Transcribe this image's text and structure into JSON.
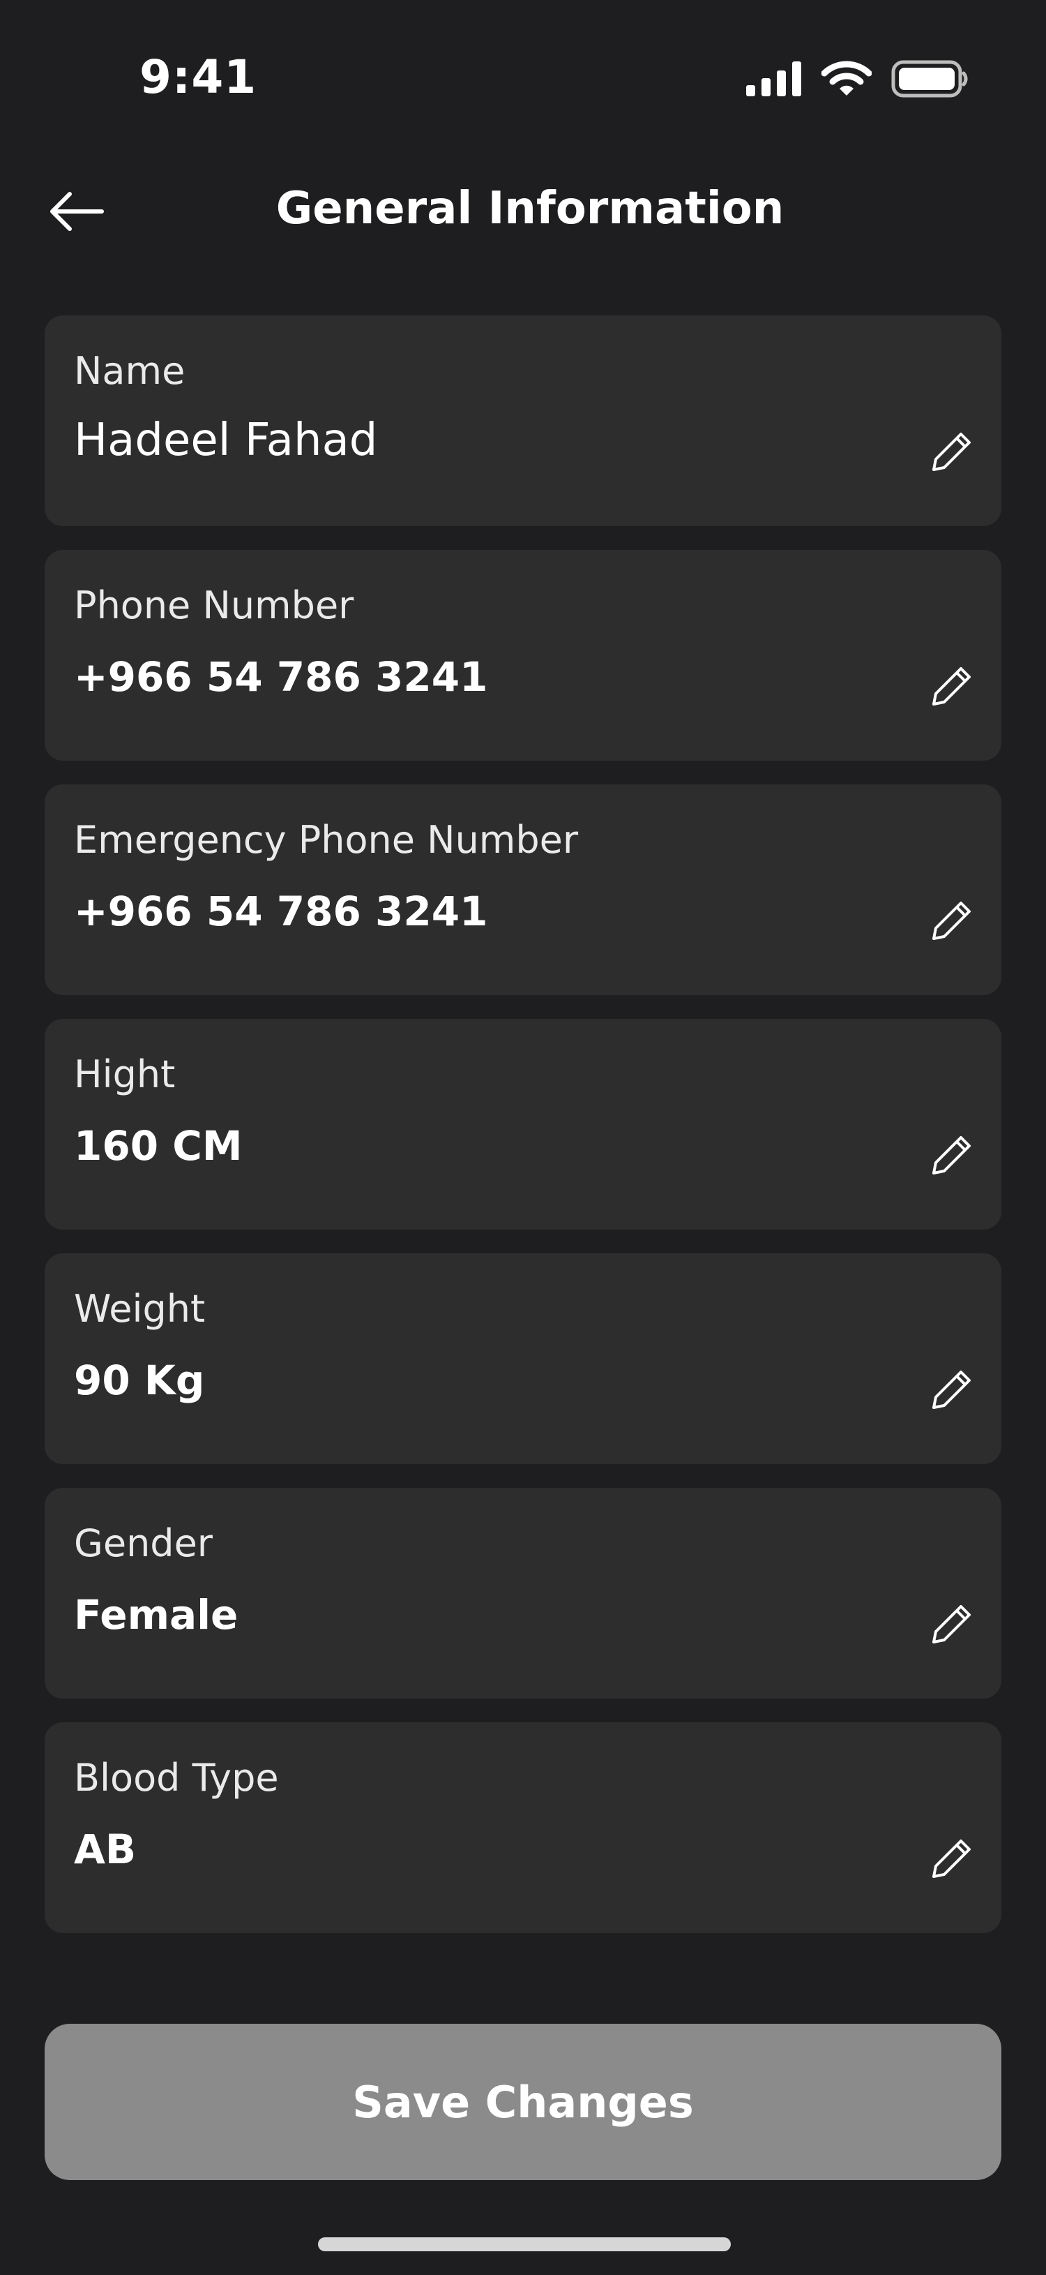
{
  "status_bar": {
    "time": "9:41"
  },
  "header": {
    "title": "General Information"
  },
  "fields": [
    {
      "label": "Name",
      "value": "Hadeel Fahad"
    },
    {
      "label": "Phone Number",
      "value": "+966 54 786 3241"
    },
    {
      "label": "Emergency Phone Number",
      "value": "+966 54 786 3241"
    },
    {
      "label": "Hight",
      "value": "160 CM"
    },
    {
      "label": "Weight",
      "value": "90 Kg"
    },
    {
      "label": "Gender",
      "value": "Female"
    },
    {
      "label": "Blood Type",
      "value": "AB"
    }
  ],
  "actions": {
    "save_label": "Save Changes"
  },
  "colors": {
    "background": "#1e1e20",
    "card": "#2d2d2e",
    "save_button": "#8b8b8b",
    "text": "#ffffff"
  }
}
